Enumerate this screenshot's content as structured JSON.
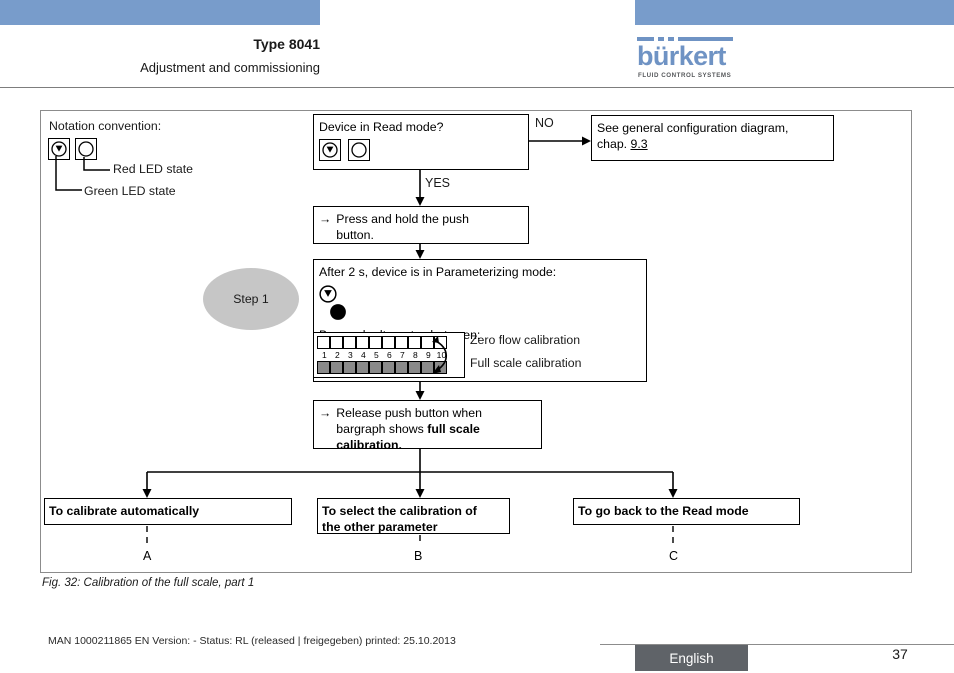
{
  "header": {
    "title": "Type 8041",
    "subtitle": "Adjustment and commissioning",
    "logo_word": "bürkert",
    "logo_tagline": "FLUID CONTROL SYSTEMS",
    "bar_color": "#789ccb",
    "logo_color": "#6f93c4"
  },
  "legend": {
    "title": "Notation convention:",
    "red_led_label": "Red LED state",
    "green_led_label": "Green LED state",
    "icon_red": "led-blinking-icon",
    "icon_green": "led-off-icon"
  },
  "flow": {
    "read_mode": {
      "question": "Device in Read mode?",
      "icon_left": "led-blinking-icon",
      "icon_right": "led-off-icon"
    },
    "no_label": "NO",
    "yes_label": "YES",
    "config_ref": {
      "line1": "See general configuration diagram,",
      "chap_prefix": "chap. ",
      "chap_link": "9.3"
    },
    "press_hold": {
      "arrow": "→",
      "line1": "Press and hold the push",
      "line2": "button."
    },
    "param_mode": {
      "heading": "After 2 s, device is in Parameterizing mode:",
      "icon_left": "led-blinking-icon",
      "icon_right": "led-on-icon",
      "bargraph_heading": "Bargraph alternates between:",
      "zero_flow": "Zero flow calibration",
      "full_scale": "Full scale calibration"
    },
    "release": {
      "arrow": "→",
      "line1": "Release push button when",
      "line2_normal": "bargraph shows ",
      "line2_bold": "full scale",
      "line3_bold": "calibration."
    },
    "step_label": "Step 1",
    "outcomes": [
      {
        "text": "To calibrate automatically",
        "letter": "A"
      },
      {
        "text_line1": "To select the calibration of",
        "text_line2": "the other parameter",
        "letter": "B"
      },
      {
        "text": "To go back to the Read mode",
        "letter": "C"
      }
    ]
  },
  "bargraph": {
    "numbers": [
      "1",
      "2",
      "3",
      "4",
      "5",
      "6",
      "7",
      "8",
      "9",
      "10"
    ],
    "top_row_filled": [
      false,
      false,
      false,
      false,
      false,
      false,
      false,
      false,
      false,
      false
    ],
    "bottom_row_filled": [
      true,
      true,
      true,
      true,
      true,
      true,
      true,
      true,
      true,
      true
    ]
  },
  "caption": "Fig. 32:  Calibration of the full scale, part 1",
  "footer": {
    "text": "MAN  1000211865  EN  Version: - Status: RL (released | freigegeben)  printed: 25.10.2013",
    "language": "English",
    "page_number": "37",
    "badge_color": "#5f6368"
  }
}
